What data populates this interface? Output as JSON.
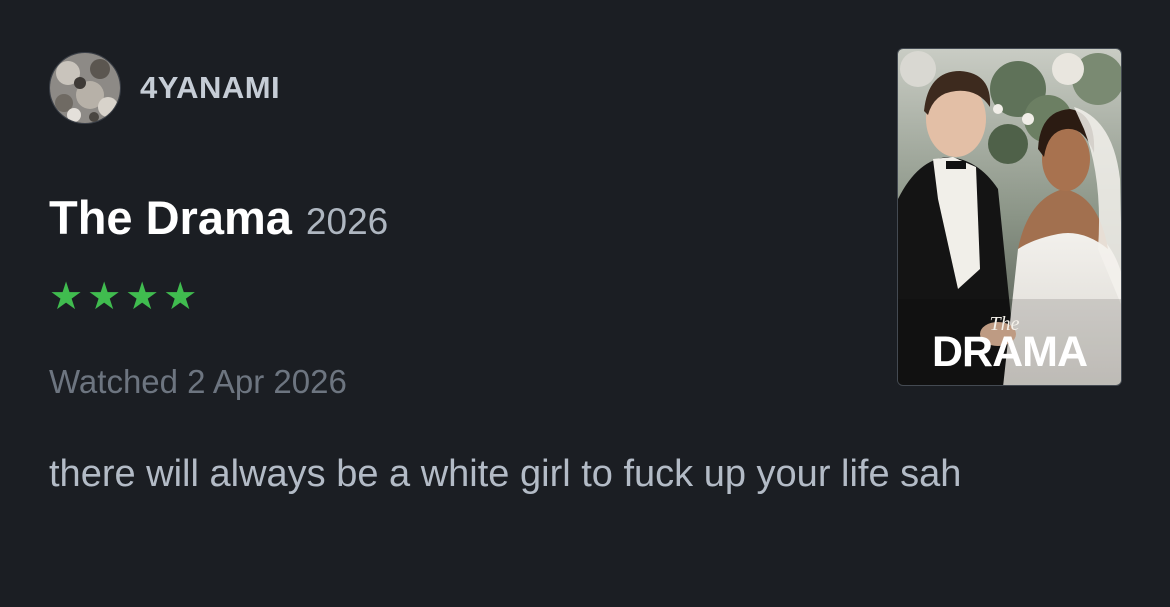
{
  "review": {
    "author": {
      "username": "4YANAMI",
      "avatar_icon": "avatar-image"
    },
    "film": {
      "title": "The Drama",
      "year": "2026"
    },
    "rating": {
      "stars": 4,
      "max": 5,
      "glyphs": [
        "★",
        "★",
        "★",
        "★"
      ],
      "color": "#40bc4f"
    },
    "watched_text": "Watched 2 Apr 2026",
    "body": "there will always be a white girl to fuck up your life sah",
    "poster": {
      "the_text": "The",
      "title_text": "DRAMA"
    }
  },
  "colors": {
    "background": "#1b1e23",
    "username": "#c6cdd6",
    "title": "#ffffff",
    "year": "#aeb6c0",
    "watched": "#6d7580",
    "body": "#b3bbc6",
    "star": "#40bc4f"
  }
}
